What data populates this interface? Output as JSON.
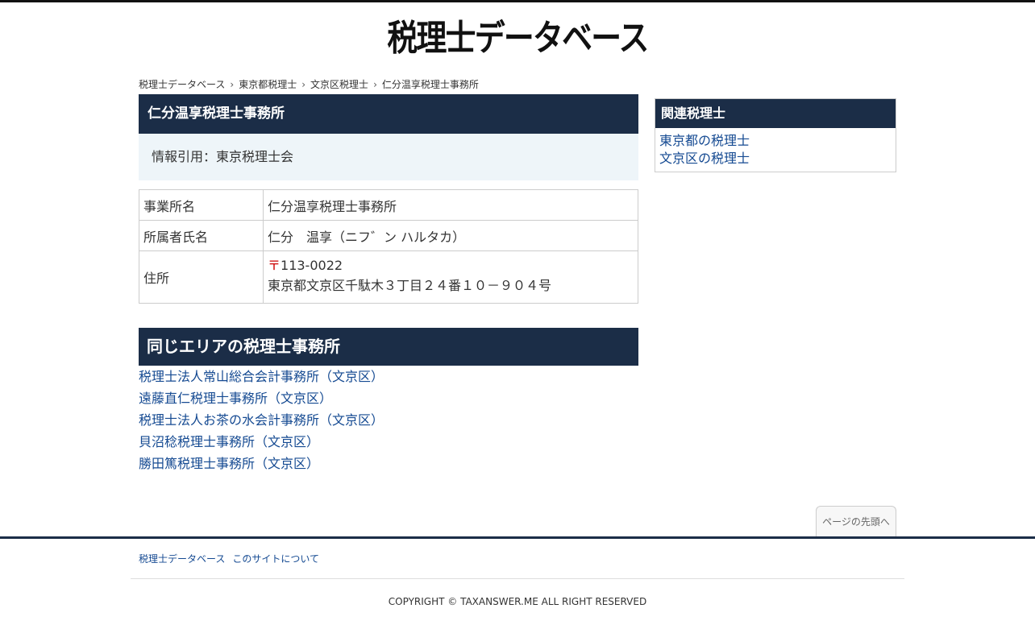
{
  "site": {
    "logo_text": "税理士データベース"
  },
  "breadcrumb": {
    "items": [
      "税理士データベース",
      "東京都税理士",
      "文京区税理士",
      "仁分温享税理士事務所"
    ],
    "separator": "›"
  },
  "office": {
    "title": "仁分温享税理士事務所",
    "source": "情報引用：東京税理士会",
    "rows": {
      "name": {
        "label": "事業所名",
        "value": "仁分温享税理士事務所"
      },
      "member": {
        "label": "所属者氏名",
        "value": "仁分　温享（ニフ゛ン ハルタカ）"
      },
      "address": {
        "label": "住所",
        "postal_mark": "〒",
        "postal_code": "113-0022",
        "value": "東京都文京区千駄木３丁目２４番１０－９０４号"
      }
    }
  },
  "area": {
    "title": "同じエリアの税理士事務所",
    "links": [
      "税理士法人常山総合会計事務所（文京区）",
      "遠藤直仁税理士事務所（文京区）",
      "税理士法人お茶の水会計事務所（文京区）",
      "貝沼稔税理士事務所（文京区）",
      "勝田篤税理士事務所（文京区）"
    ]
  },
  "sidebar": {
    "title": "関連税理士",
    "links": [
      "東京都の税理士",
      "文京区の税理士"
    ]
  },
  "page_top": {
    "label": "ページの先頭へ"
  },
  "footer": {
    "links": [
      "税理士データベース",
      "このサイトについて"
    ],
    "copyright": "COPYRIGHT © TAXANSWER.ME ALL RIGHT RESERVED"
  },
  "colors": {
    "header_bg": "#1b2d47",
    "link": "#154a92",
    "source_bg": "#eef5f9",
    "postal_mark": "#cc0000"
  }
}
